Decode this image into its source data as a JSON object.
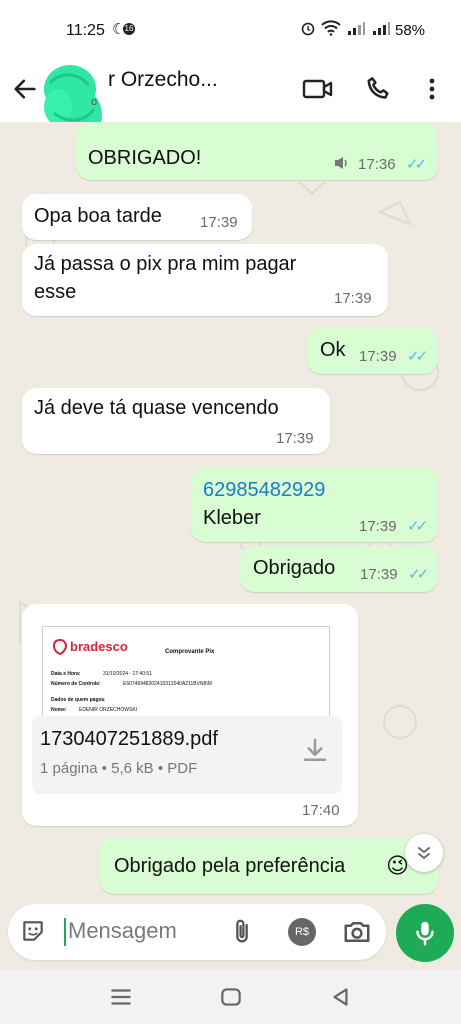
{
  "status_bar": {
    "time": "11:25",
    "notification_count": "16",
    "battery": "58%",
    "icons": [
      "moon-icon",
      "alarm-icon",
      "wifi-icon",
      "signal-icon",
      "signal-icon"
    ]
  },
  "header": {
    "contact_name": "r Orzecho...",
    "contact_status": "o",
    "icons": [
      "back-arrow-icon",
      "video-call-icon",
      "phone-icon",
      "more-vert-icon"
    ]
  },
  "messages": [
    {
      "direction": "out",
      "text": "OBRIGADO!",
      "time": "17:36",
      "ticks": "✓✓"
    },
    {
      "direction": "in",
      "text": "Opa boa tarde",
      "time": "17:39"
    },
    {
      "direction": "in",
      "line1": "Já passa o pix pra mim pagar",
      "line2": "esse",
      "time": "17:39"
    },
    {
      "direction": "out",
      "text": "Ok",
      "time": "17:39",
      "ticks": "✓✓"
    },
    {
      "direction": "in",
      "text": "Já deve tá quase vencendo",
      "time": "17:39"
    },
    {
      "direction": "out",
      "line1": "62985482929",
      "line2": "Kleber",
      "time": "17:39",
      "ticks": "✓✓"
    },
    {
      "direction": "out",
      "text": "Obrigado",
      "time": "17:39",
      "ticks": "✓✓"
    },
    {
      "direction": "in",
      "type": "document",
      "preview": {
        "bank": "bradesco",
        "doc_title": "Comprovante Pix",
        "line1": "Data e Hora:",
        "line1_val": "31/10/2024 - 17:40:51",
        "line2": "Número de Controle:",
        "line2_val": "E60746948202410312040A211BVN8IM",
        "line3": "Dados de quem pagou",
        "line4": "Nome:",
        "line4_val": "EDENIR ORZECHOWSKI"
      },
      "filename": "1730407251889.pdf",
      "meta": "1 página • 5,6 kB • PDF",
      "time": "17:40"
    },
    {
      "direction": "out",
      "text": "Obrigado pela preferência",
      "emoji": "😉"
    }
  ],
  "compose": {
    "placeholder": "Mensagem",
    "icons": [
      "sticker-icon",
      "attach-icon",
      "pix-icon",
      "camera-icon",
      "mic-icon"
    ],
    "pix_label": "R$"
  },
  "colors": {
    "outgoing": "#d9fdd3",
    "incoming": "#ffffff",
    "accent": "#1faa55",
    "read_ticks": "#53bdeb",
    "link": "#1b7bc4",
    "background": "#efeae2"
  }
}
